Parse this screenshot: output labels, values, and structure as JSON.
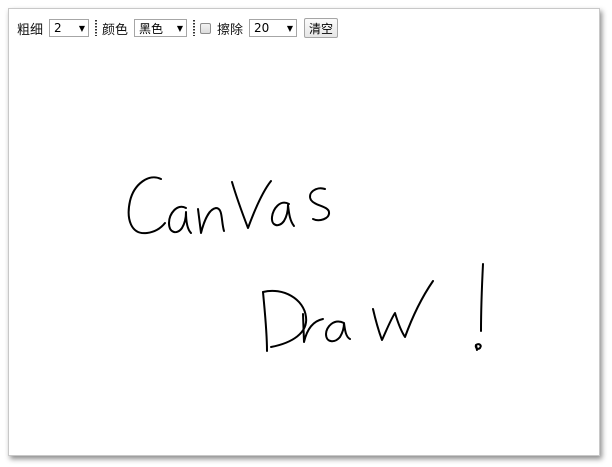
{
  "toolbar": {
    "size_label": "粗细",
    "size_value": "2",
    "color_label": "颜色",
    "color_value": "黑色",
    "erase_label": "擦除",
    "erase_checked": false,
    "erase_size_value": "20",
    "clear_label": "清空"
  },
  "canvas": {
    "stroke_color": "#000000"
  }
}
